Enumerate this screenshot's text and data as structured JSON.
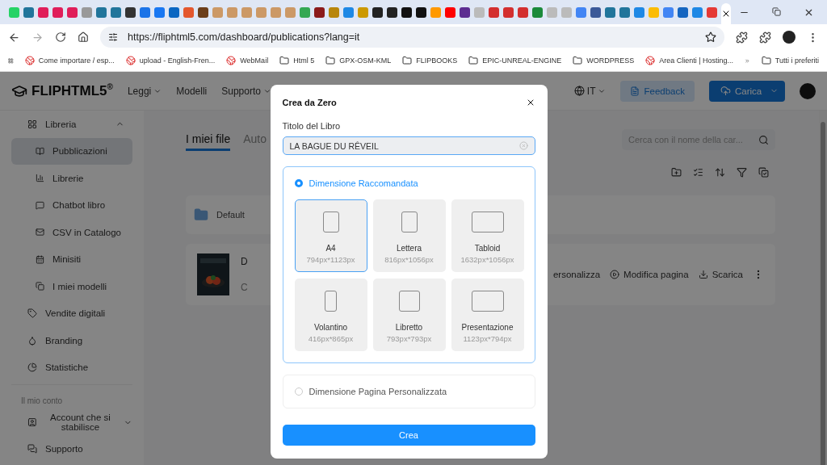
{
  "browser": {
    "url": "https://fliphtml5.com/dashboard/publications?lang=it",
    "bookmarks": [
      {
        "label": "Come importare / esp...",
        "kind": "site"
      },
      {
        "label": "upload - English-Fren...",
        "kind": "site"
      },
      {
        "label": "WebMail",
        "kind": "site"
      },
      {
        "label": "Html 5",
        "kind": "folder"
      },
      {
        "label": "GPX-OSM-KML",
        "kind": "folder"
      },
      {
        "label": "FLIPBOOKS",
        "kind": "folder"
      },
      {
        "label": "EPIC-UNREAL-ENGINE",
        "kind": "folder"
      },
      {
        "label": "WORDPRESS",
        "kind": "folder"
      },
      {
        "label": "Area Clienti | Hosting...",
        "kind": "site"
      }
    ],
    "all_bookmarks": "Tutti i preferiti"
  },
  "header": {
    "logo": "FLIPHTML5",
    "logo_mark": "®",
    "nav": [
      {
        "label": "Leggi",
        "dropdown": true
      },
      {
        "label": "Modelli",
        "dropdown": false
      },
      {
        "label": "Supporto",
        "dropdown": true
      }
    ],
    "language": "IT",
    "feedback": "Feedback",
    "upload": "Carica"
  },
  "sidebar": {
    "items": [
      {
        "label": "Libreria",
        "expanded": true,
        "selected": false,
        "children": [
          {
            "label": "Pubblicazioni",
            "selected": true
          },
          {
            "label": "Librerie",
            "selected": false
          },
          {
            "label": "Chatbot libro",
            "selected": false
          },
          {
            "label": "CSV in Catalogo",
            "selected": false
          },
          {
            "label": "Minisiti",
            "selected": false
          },
          {
            "label": "I miei modelli",
            "selected": false
          }
        ]
      },
      {
        "label": "Vendite digitali",
        "selected": false
      },
      {
        "label": "Branding",
        "selected": false
      },
      {
        "label": "Statistiche",
        "selected": false
      }
    ],
    "section": "Il mio conto",
    "account_items": [
      {
        "label": "Account che si stabilisce",
        "dropdown": true
      },
      {
        "label": "Supporto",
        "dropdown": false
      }
    ]
  },
  "main": {
    "tabs": [
      {
        "label": "I miei file",
        "selected": true
      },
      {
        "label": "Auto",
        "selected": false
      }
    ],
    "search": {
      "placeholder": "Cerca con il nome della car..."
    },
    "folder": "Default",
    "book": {
      "title": "D",
      "subtitle": "C",
      "actions": [
        "ersonalizza",
        "Modifica pagina",
        "Scarica"
      ]
    }
  },
  "dialog": {
    "title": "Crea da Zero",
    "field_label": "Titolo del Libro",
    "field_value": "LA BAGUE DU RÊVEIL",
    "options": [
      {
        "label": "Dimensione Raccomandata",
        "selected": true,
        "sizes": [
          {
            "name": "A4",
            "dims": "794px*1123px",
            "kind": "portrait",
            "selected": true
          },
          {
            "name": "Lettera",
            "dims": "816px*1056px",
            "kind": "portrait",
            "selected": false
          },
          {
            "name": "Tabloid",
            "dims": "1632px*1056px",
            "kind": "landscape",
            "selected": false
          },
          {
            "name": "Volantino",
            "dims": "416px*865px",
            "kind": "narrow",
            "selected": false
          },
          {
            "name": "Libretto",
            "dims": "793px*793px",
            "kind": "square",
            "selected": false
          },
          {
            "name": "Presentazione",
            "dims": "1123px*794px",
            "kind": "landscape",
            "selected": false
          }
        ]
      },
      {
        "label": "Dimensione Pagina Personalizzata",
        "selected": false
      }
    ],
    "submit": "Crea"
  }
}
